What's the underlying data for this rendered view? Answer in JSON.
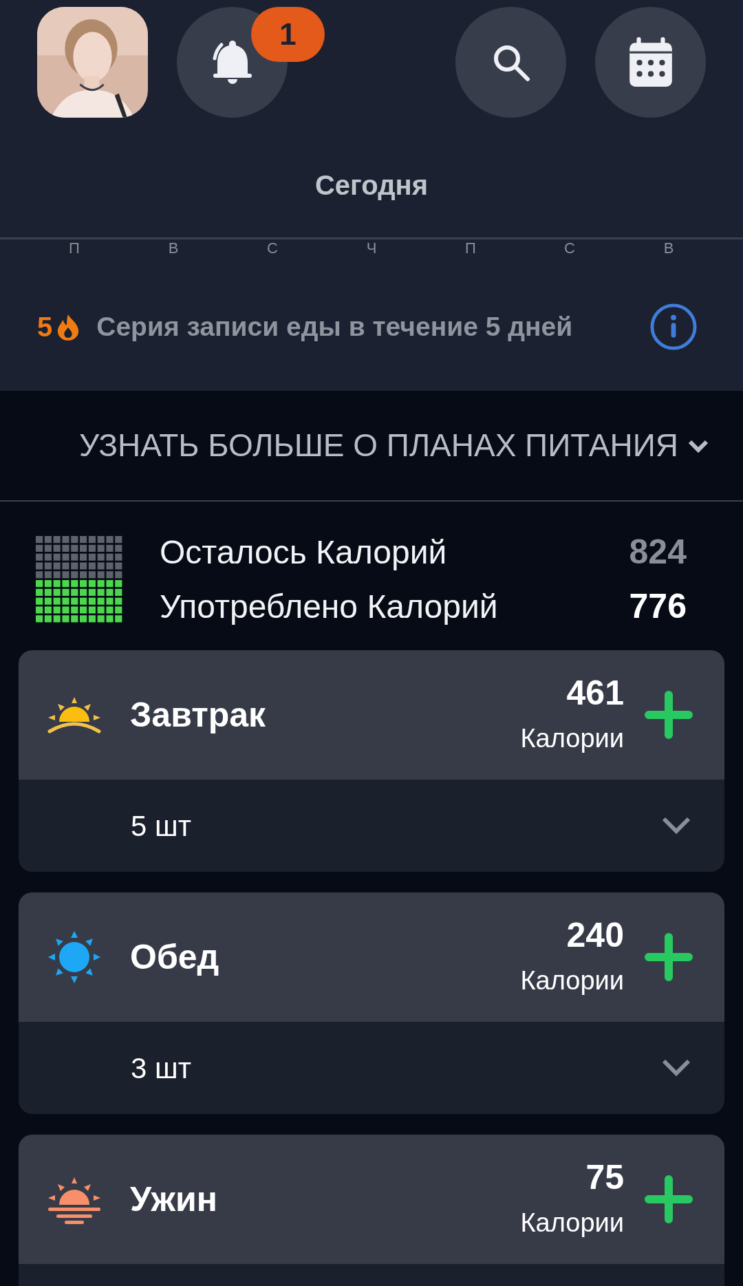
{
  "header": {
    "notifications": {
      "badge": "1"
    },
    "title": "Сегодня"
  },
  "week_days": [
    {
      "label": "П"
    },
    {
      "label": "В"
    },
    {
      "label": "С"
    },
    {
      "label": "Ч"
    },
    {
      "label": "П"
    },
    {
      "label": "С"
    },
    {
      "label": "В"
    }
  ],
  "streak": {
    "count": "5",
    "text": "Серия записи еды в течение 5 дней"
  },
  "meal_plans_link": {
    "label": "УЗНАТЬ БОЛЬШЕ О ПЛАНАХ ПИТАНИЯ"
  },
  "calories": {
    "rows": [
      {
        "label": "Осталось Калорий",
        "value": "824",
        "kind": "remaining"
      },
      {
        "label": "Употреблено Калорий",
        "value": "776",
        "kind": "consumed"
      }
    ]
  },
  "meals": [
    {
      "kind": "sunrise",
      "name": "Завтрак",
      "calories": "461",
      "unit": "Калории",
      "count": "5 шт"
    },
    {
      "kind": "sun",
      "name": "Обед",
      "calories": "240",
      "unit": "Калории",
      "count": "3 шт"
    },
    {
      "kind": "sunset",
      "name": "Ужин",
      "calories": "75",
      "unit": "Калории"
    }
  ]
}
